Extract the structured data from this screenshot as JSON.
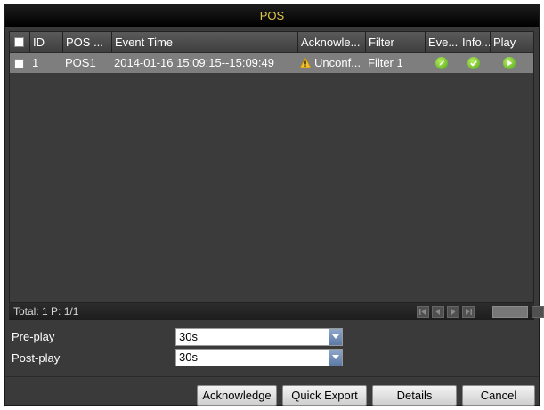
{
  "window": {
    "title": "POS"
  },
  "table": {
    "columns": [
      "ID",
      "POS ...",
      "Event Time",
      "Acknowle...",
      "Filter",
      "Eve...",
      "Info...",
      "Play"
    ],
    "rows": [
      {
        "id": "1",
        "pos": "POS1",
        "event_time": "2014-01-16 15:09:15--15:09:49",
        "ack": "Unconf...",
        "filter": "Filter 1",
        "ack_icon": "warning-icon",
        "event_icon": "edit-icon",
        "info_icon": "check-icon",
        "play_icon": "play-icon"
      }
    ]
  },
  "footer": {
    "status": "Total: 1  P: 1/1"
  },
  "pre_play": {
    "label": "Pre-play",
    "value": "30s"
  },
  "post_play": {
    "label": "Post-play",
    "value": "30s"
  },
  "buttons": {
    "acknowledge": "Acknowledge",
    "quick_export": "Quick Export",
    "details": "Details",
    "cancel": "Cancel"
  },
  "colors": {
    "title": "#e0c84a",
    "selected_row": "#7e7e7e",
    "icon_green": "#4ba41a",
    "warning": "#f2c230"
  }
}
